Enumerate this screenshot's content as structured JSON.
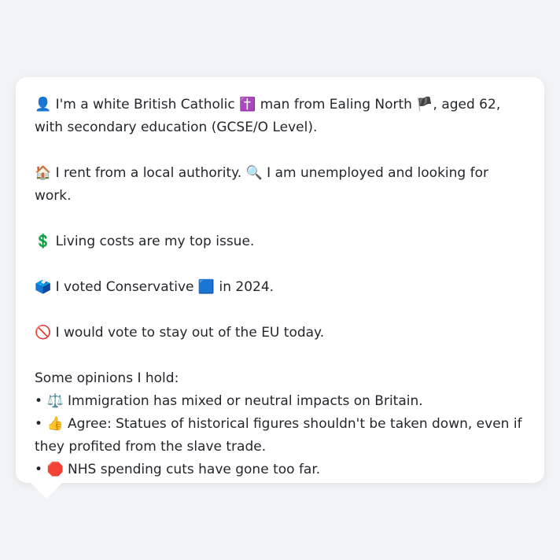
{
  "persona": {
    "identity": {
      "icon_emoji": "👤",
      "text_a": "I'm a white British Catholic",
      "religion_emoji": "✝️",
      "text_b": "man from Ealing North",
      "flag_emoji": "🏴",
      "text_c": ", aged 62, with secondary education (GCSE/O Level)."
    },
    "housing": {
      "home_emoji": "🏠",
      "home_text": "I rent from a local authority.",
      "work_emoji": "🔍",
      "work_text": "I am unemployed and looking for work."
    },
    "issue": {
      "emoji": "💲",
      "text": "Living costs are my top issue."
    },
    "vote": {
      "emoji": "🗳️",
      "text_a": "I voted Conservative",
      "party_emoji": "🟦",
      "text_b": "in 2024."
    },
    "eu": {
      "emoji": "🚫",
      "text": "I would vote to stay out of the EU today."
    },
    "opinions": {
      "heading": "Some opinions I hold:",
      "bullet": "•",
      "items": [
        {
          "emoji": "⚖️",
          "text": "Immigration has mixed or neutral impacts on Britain."
        },
        {
          "emoji": "👍",
          "text": "Agree: Statues of historical figures shouldn't be taken down, even if they profited from the slave trade."
        },
        {
          "emoji": "🛑",
          "text": "NHS spending cuts have gone too far."
        }
      ]
    }
  }
}
